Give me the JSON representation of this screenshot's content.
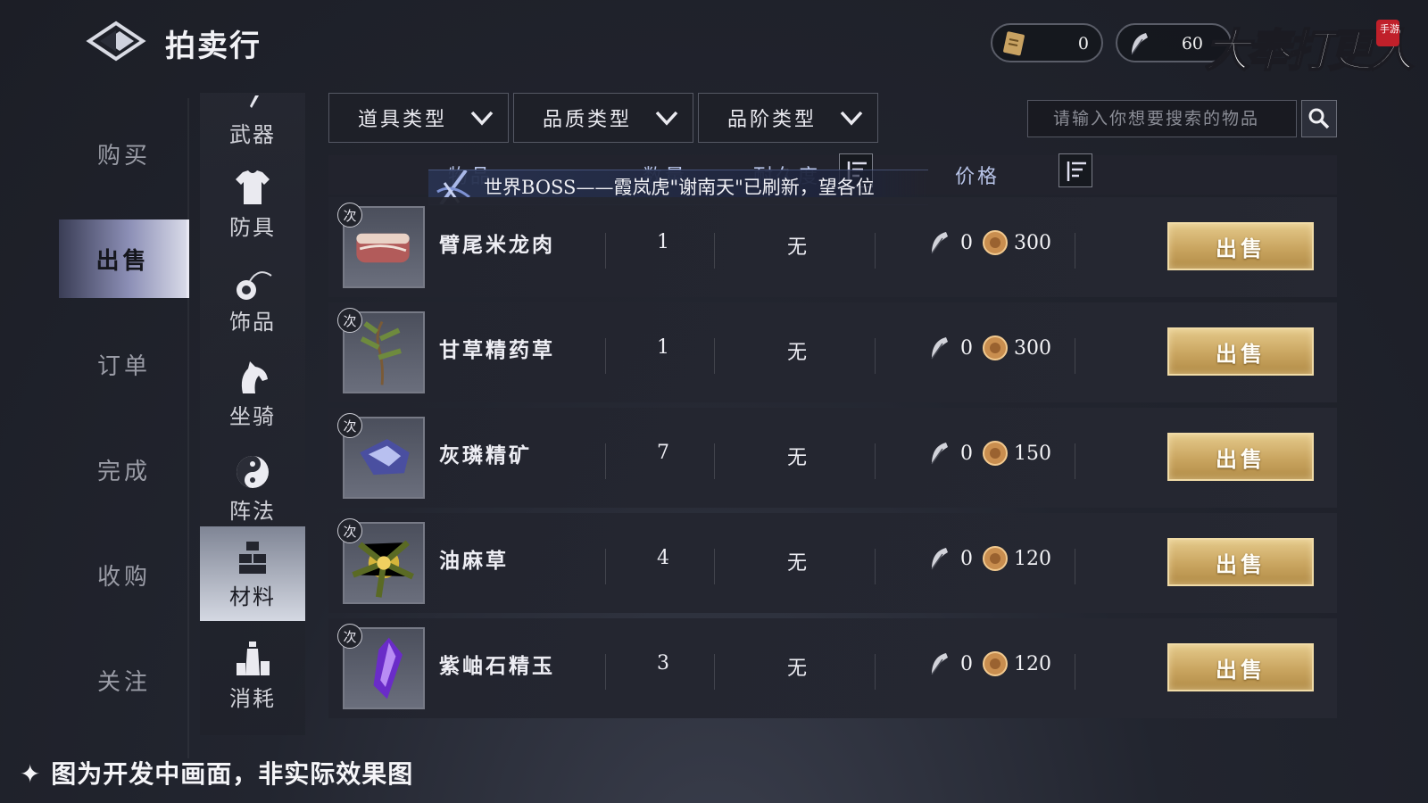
{
  "header": {
    "title": "拍卖行",
    "currency_ticket": "0",
    "currency_feather": "60",
    "logo_text": "大奉打更人",
    "logo_badge": "手游"
  },
  "main_nav": [
    {
      "label": "购买",
      "active": false
    },
    {
      "label": "出售",
      "active": true
    },
    {
      "label": "订单",
      "active": false
    },
    {
      "label": "完成",
      "active": false
    },
    {
      "label": "收购",
      "active": false
    },
    {
      "label": "关注",
      "active": false
    }
  ],
  "sub_nav": [
    {
      "label": "武器",
      "icon": "sword-icon"
    },
    {
      "label": "防具",
      "icon": "armor-icon"
    },
    {
      "label": "饰品",
      "icon": "accessory-icon"
    },
    {
      "label": "坐骑",
      "icon": "horse-icon"
    },
    {
      "label": "阵法",
      "icon": "formation-icon"
    },
    {
      "label": "材料",
      "icon": "material-icon",
      "active": true
    },
    {
      "label": "消耗",
      "icon": "potion-icon"
    }
  ],
  "filters": [
    {
      "label": "道具类型"
    },
    {
      "label": "品质类型"
    },
    {
      "label": "品阶类型"
    }
  ],
  "search": {
    "placeholder": "请输入你想要搜索的物品"
  },
  "table": {
    "col_item": "物品",
    "col_qty": "数量",
    "col_durability": "耐久度",
    "col_price": "价格"
  },
  "broadcast": "世界BOSS——霞岚虎\"谢南天\"已刷新，望各位",
  "items": [
    {
      "name": "臂尾米龙肉",
      "qty": "1",
      "durability": "无",
      "feather": "0",
      "coin": "300",
      "badge": "次",
      "thumb": "meat"
    },
    {
      "name": "甘草精药草",
      "qty": "1",
      "durability": "无",
      "feather": "0",
      "coin": "300",
      "badge": "次",
      "thumb": "herb"
    },
    {
      "name": "灰璘精矿",
      "qty": "7",
      "durability": "无",
      "feather": "0",
      "coin": "150",
      "badge": "次",
      "thumb": "ore"
    },
    {
      "name": "油麻草",
      "qty": "4",
      "durability": "无",
      "feather": "0",
      "coin": "120",
      "badge": "次",
      "thumb": "grass"
    },
    {
      "name": "紫岫石精玉",
      "qty": "3",
      "durability": "无",
      "feather": "0",
      "coin": "120",
      "badge": "次",
      "thumb": "jade"
    }
  ],
  "sell_label": "出售",
  "footer_note": "✦ 图为开发中画面，非实际效果图",
  "colors": {
    "accent_gold": "#c9a560",
    "header_text": "#b8c4e8"
  }
}
